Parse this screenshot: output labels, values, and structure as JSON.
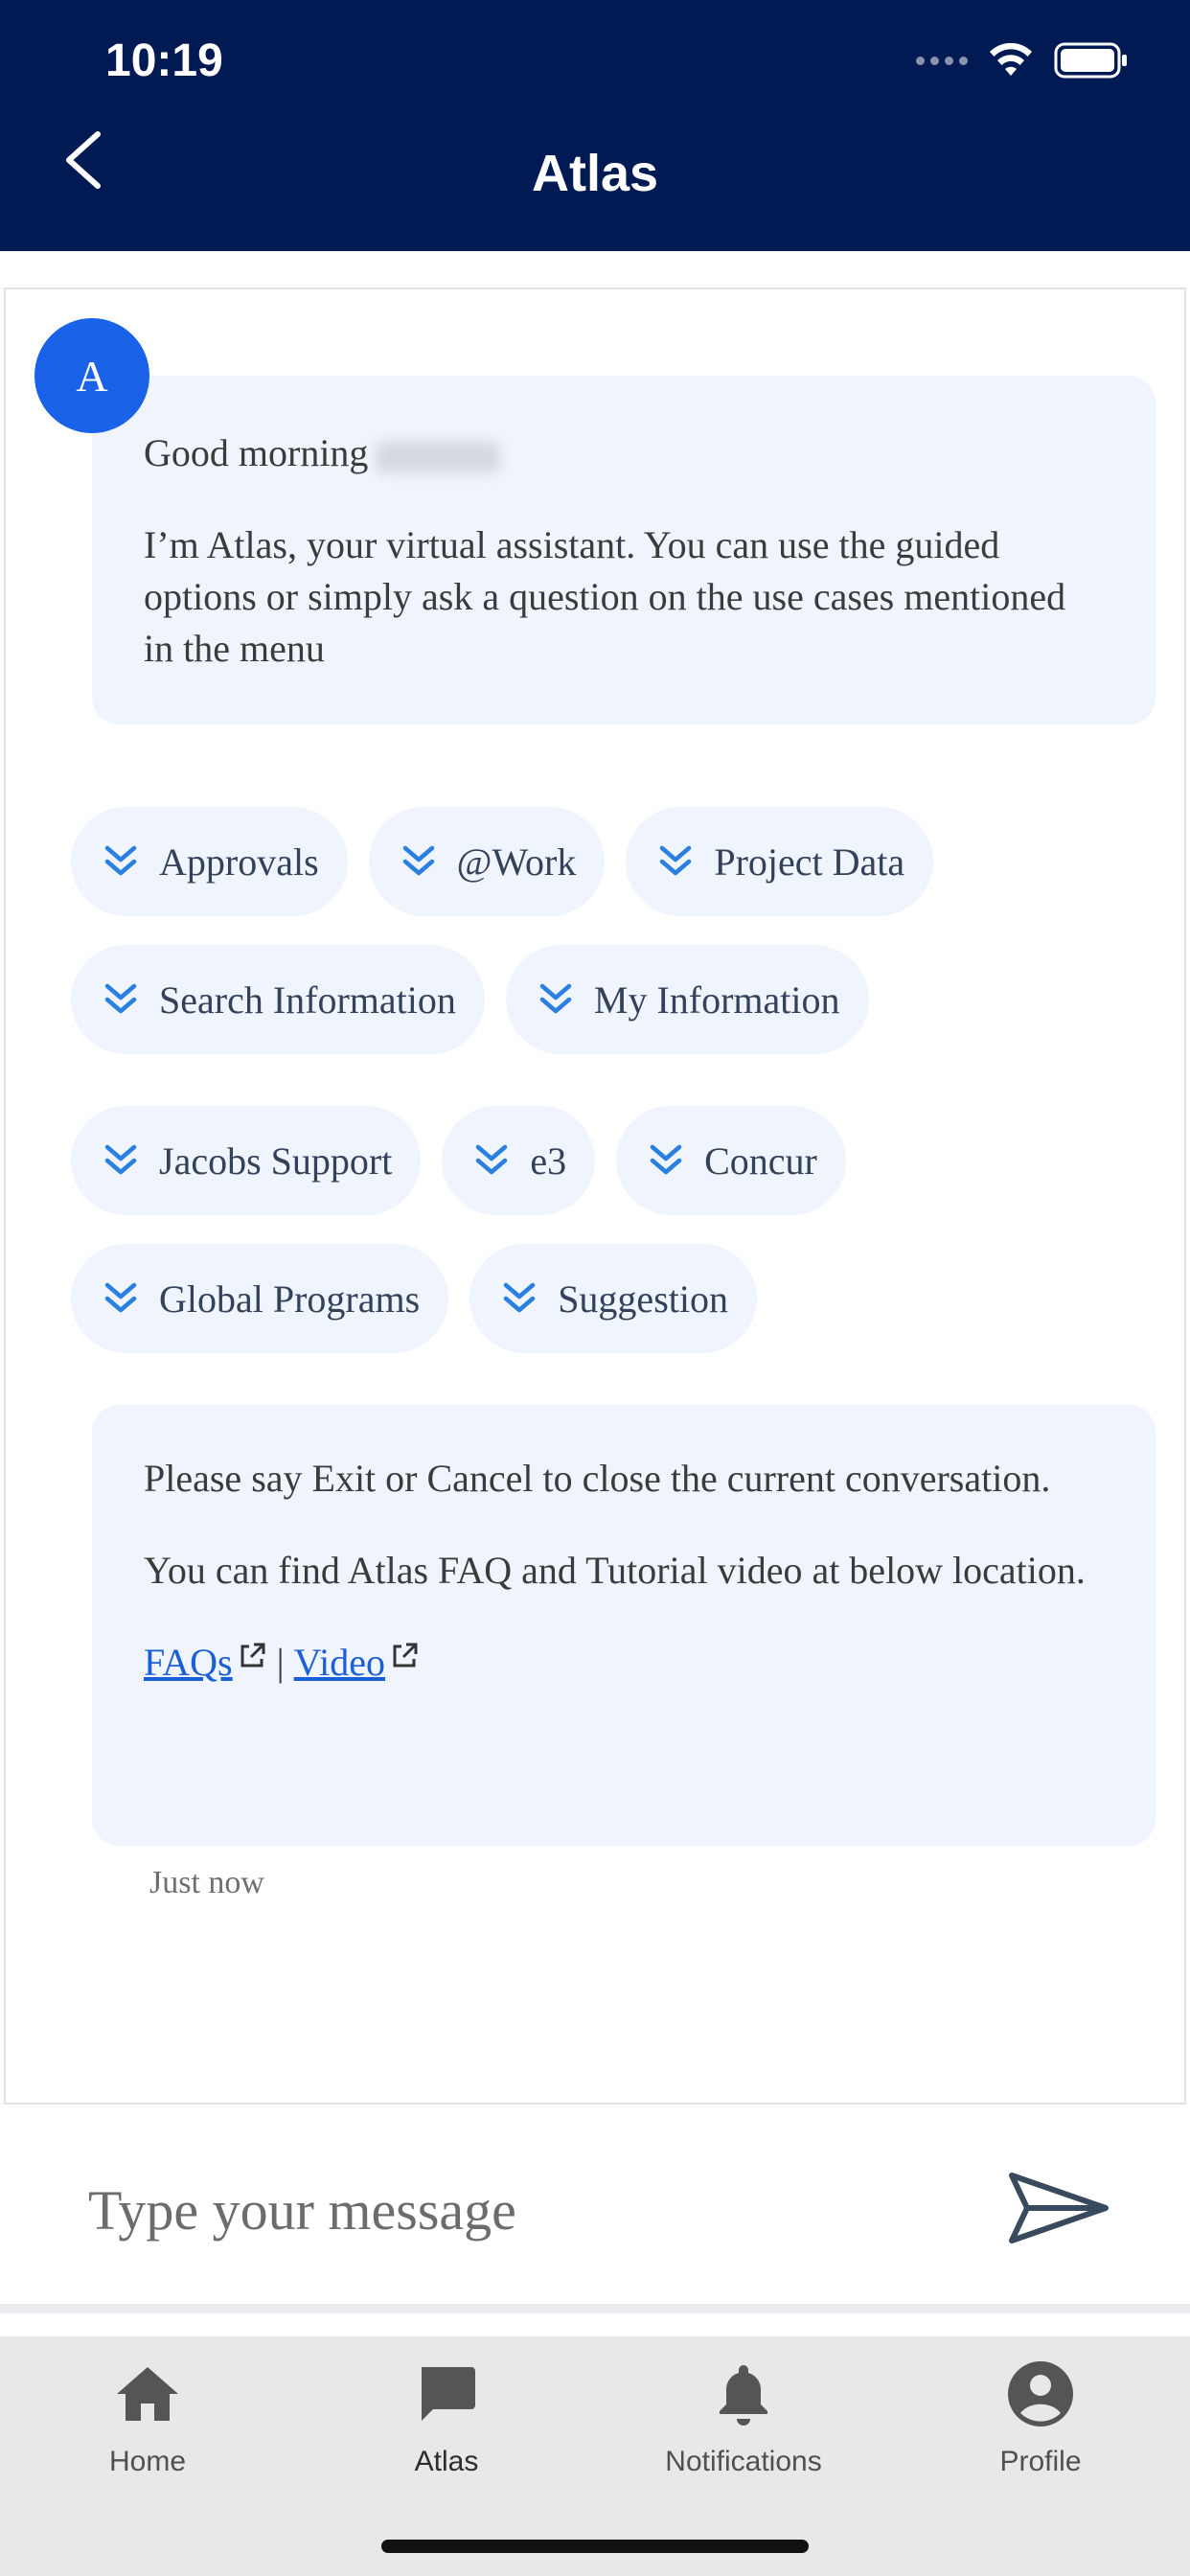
{
  "status_bar": {
    "time": "10:19"
  },
  "header": {
    "title": "Atlas"
  },
  "bot": {
    "avatar_letter": "A"
  },
  "greeting": {
    "line": "Good morning",
    "intro": "I’m Atlas, your virtual assistant. You can use the guided options or simply ask a question on the use cases mentioned in the menu"
  },
  "chips": {
    "row1": [
      "Approvals",
      "@Work",
      "Project Data"
    ],
    "row2": [
      "Search Information",
      "My Information"
    ],
    "row3": [
      "Jacobs Support",
      "e3",
      "Concur"
    ],
    "row4": [
      "Global Programs",
      "Suggestion"
    ]
  },
  "info": {
    "exit_text": "Please say Exit or Cancel to close the current conversation.",
    "faq_text": "You can find Atlas FAQ and Tutorial video at below location.",
    "faq_link": "FAQs",
    "separator": "|",
    "video_link": "Video"
  },
  "timestamp": "Just now",
  "composer": {
    "placeholder": "Type your message"
  },
  "tabbar": {
    "items": [
      {
        "label": "Home",
        "icon": "home-icon"
      },
      {
        "label": "Atlas",
        "icon": "chat-icon"
      },
      {
        "label": "Notifications",
        "icon": "bell-icon"
      },
      {
        "label": "Profile",
        "icon": "profile-icon"
      }
    ]
  },
  "colors": {
    "header_bg": "#011a53",
    "avatar": "#1a63e8",
    "bubble_bg": "#f0f5fd",
    "chevron": "#2a7fe0"
  }
}
